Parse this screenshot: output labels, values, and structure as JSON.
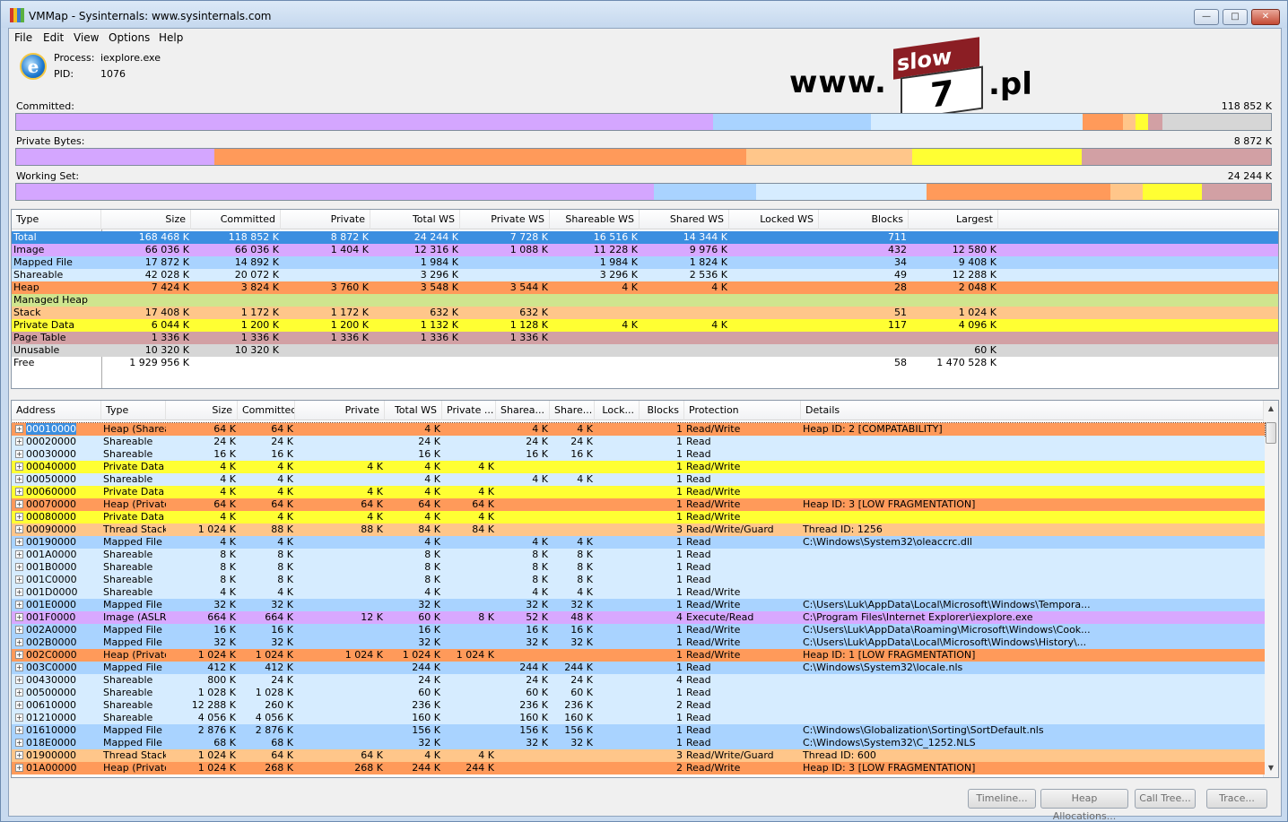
{
  "window": {
    "title": "VMMap - Sysinternals: www.sysinternals.com",
    "buttons": {
      "minimize": "—",
      "maximize": "□",
      "close": "✕"
    }
  },
  "menu": [
    "File",
    "Edit",
    "View",
    "Options",
    "Help"
  ],
  "process": {
    "process_label": "Process:",
    "process_value": "iexplore.exe",
    "pid_label": "PID:",
    "pid_value": "1076"
  },
  "logo": {
    "www": "www.",
    "slow": "slow",
    "seven": "7",
    "pl": ".pl"
  },
  "colors": {
    "image": "#d8a8ff",
    "mapped": "#a9d3ff",
    "shareable": "#d6ecff",
    "heap": "#ff9a5a",
    "managed": "#cfe58e",
    "stack": "#ffc68a",
    "private": "#ffff33",
    "pagetable": "#d2a0a4",
    "unusable": "#d6d6d6",
    "total": "#3b8ee0"
  },
  "bars": [
    {
      "label": "Committed:",
      "value": "118 852 K",
      "segments": [
        {
          "color": "#d4a6ff",
          "frac": 0.5557
        },
        {
          "color": "#a9d3ff",
          "frac": 0.1253
        },
        {
          "color": "#d6ecff",
          "frac": 0.1689
        },
        {
          "color": "#ff9a5a",
          "frac": 0.0322
        },
        {
          "color": "#ffc68a",
          "frac": 0.0099
        },
        {
          "color": "#ffff33",
          "frac": 0.0101
        },
        {
          "color": "#d2a0a4",
          "frac": 0.0112
        },
        {
          "color": "#d6d6d6",
          "frac": 0.0868
        }
      ]
    },
    {
      "label": "Private Bytes:",
      "value": "8 872 K",
      "segments": [
        {
          "color": "#d4a6ff",
          "frac": 0.1582
        },
        {
          "color": "#ff9a5a",
          "frac": 0.4238
        },
        {
          "color": "#ffc68a",
          "frac": 0.132
        },
        {
          "color": "#ffff33",
          "frac": 0.1353
        },
        {
          "color": "#d2a0a4",
          "frac": 0.1506
        }
      ]
    },
    {
      "label": "Working Set:",
      "value": "24 244 K",
      "segments": [
        {
          "color": "#d4a6ff",
          "frac": 0.508
        },
        {
          "color": "#a9d3ff",
          "frac": 0.0818
        },
        {
          "color": "#d6ecff",
          "frac": 0.1359
        },
        {
          "color": "#ff9a5a",
          "frac": 0.1463
        },
        {
          "color": "#ffc68a",
          "frac": 0.0261
        },
        {
          "color": "#ffff33",
          "frac": 0.0467
        },
        {
          "color": "#d2a0a4",
          "frac": 0.0551
        }
      ]
    }
  ],
  "summary": {
    "headers": [
      "Type",
      "Size",
      "Committed",
      "Private",
      "Total WS",
      "Private WS",
      "Shareable WS",
      "Shared WS",
      "Locked WS",
      "Blocks",
      "Largest"
    ],
    "rows": [
      {
        "bg": "#3b8ee0",
        "fg": "#ffffff",
        "cells": [
          "Total",
          "168 468 K",
          "118 852 K",
          "8 872 K",
          "24 244 K",
          "7 728 K",
          "16 516 K",
          "14 344 K",
          "",
          "711",
          ""
        ]
      },
      {
        "bg": "#d8a8ff",
        "fg": "#000",
        "cells": [
          "Image",
          "66 036 K",
          "66 036 K",
          "1 404 K",
          "12 316 K",
          "1 088 K",
          "11 228 K",
          "9 976 K",
          "",
          "432",
          "12 580 K"
        ]
      },
      {
        "bg": "#a9d3ff",
        "fg": "#000",
        "cells": [
          "Mapped File",
          "17 872 K",
          "14 892 K",
          "",
          "1 984 K",
          "",
          "1 984 K",
          "1 824 K",
          "",
          "34",
          "9 408 K"
        ]
      },
      {
        "bg": "#d6ecff",
        "fg": "#000",
        "cells": [
          "Shareable",
          "42 028 K",
          "20 072 K",
          "",
          "3 296 K",
          "",
          "3 296 K",
          "2 536 K",
          "",
          "49",
          "12 288 K"
        ]
      },
      {
        "bg": "#ff9a5a",
        "fg": "#000",
        "cells": [
          "Heap",
          "7 424 K",
          "3 824 K",
          "3 760 K",
          "3 548 K",
          "3 544 K",
          "4 K",
          "4 K",
          "",
          "28",
          "2 048 K"
        ]
      },
      {
        "bg": "#cfe58e",
        "fg": "#000",
        "cells": [
          "Managed Heap",
          "",
          "",
          "",
          "",
          "",
          "",
          "",
          "",
          "",
          ""
        ]
      },
      {
        "bg": "#ffc68a",
        "fg": "#000",
        "cells": [
          "Stack",
          "17 408 K",
          "1 172 K",
          "1 172 K",
          "632 K",
          "632 K",
          "",
          "",
          "",
          "51",
          "1 024 K"
        ]
      },
      {
        "bg": "#ffff33",
        "fg": "#000",
        "cells": [
          "Private Data",
          "6 044 K",
          "1 200 K",
          "1 200 K",
          "1 132 K",
          "1 128 K",
          "4 K",
          "4 K",
          "",
          "117",
          "4 096 K"
        ]
      },
      {
        "bg": "#d2a0a4",
        "fg": "#000",
        "cells": [
          "Page Table",
          "1 336 K",
          "1 336 K",
          "1 336 K",
          "1 336 K",
          "1 336 K",
          "",
          "",
          "",
          "",
          ""
        ]
      },
      {
        "bg": "#d6d6d6",
        "fg": "#000",
        "cells": [
          "Unusable",
          "10 320 K",
          "10 320 K",
          "",
          "",
          "",
          "",
          "",
          "",
          "",
          "60 K"
        ]
      },
      {
        "bg": "#ffffff",
        "fg": "#000",
        "cells": [
          "Free",
          "1 929 956 K",
          "",
          "",
          "",
          "",
          "",
          "",
          "",
          "58",
          "1 470 528 K"
        ]
      }
    ]
  },
  "detail": {
    "headers": [
      "Address",
      "Type",
      "Size",
      "Committed",
      "Private",
      "Total WS",
      "Private ...",
      "Sharea...",
      "Share...",
      "Lock...",
      "Blocks",
      "Protection",
      "Details"
    ],
    "sort_arrow": "^",
    "rows": [
      {
        "bg": "#ff9a5a",
        "fg": "#000",
        "sel": true,
        "cells": [
          "00010000",
          "Heap (Shareable)",
          "64 K",
          "64 K",
          "",
          "4 K",
          "",
          "4 K",
          "4 K",
          "",
          "1",
          "Read/Write",
          "Heap ID: 2 [COMPATABILITY]"
        ]
      },
      {
        "bg": "#d6ecff",
        "cells": [
          "00020000",
          "Shareable",
          "24 K",
          "24 K",
          "",
          "24 K",
          "",
          "24 K",
          "24 K",
          "",
          "1",
          "Read",
          ""
        ]
      },
      {
        "bg": "#d6ecff",
        "cells": [
          "00030000",
          "Shareable",
          "16 K",
          "16 K",
          "",
          "16 K",
          "",
          "16 K",
          "16 K",
          "",
          "1",
          "Read",
          ""
        ]
      },
      {
        "bg": "#ffff33",
        "cells": [
          "00040000",
          "Private Data",
          "4 K",
          "4 K",
          "4 K",
          "4 K",
          "4 K",
          "",
          "",
          "",
          "1",
          "Read/Write",
          ""
        ]
      },
      {
        "bg": "#d6ecff",
        "cells": [
          "00050000",
          "Shareable",
          "4 K",
          "4 K",
          "",
          "4 K",
          "",
          "4 K",
          "4 K",
          "",
          "1",
          "Read",
          ""
        ]
      },
      {
        "bg": "#ffff33",
        "cells": [
          "00060000",
          "Private Data",
          "4 K",
          "4 K",
          "4 K",
          "4 K",
          "4 K",
          "",
          "",
          "",
          "1",
          "Read/Write",
          ""
        ]
      },
      {
        "bg": "#ff9a5a",
        "cells": [
          "00070000",
          "Heap (Private Data)",
          "64 K",
          "64 K",
          "64 K",
          "64 K",
          "64 K",
          "",
          "",
          "",
          "1",
          "Read/Write",
          "Heap ID: 3 [LOW FRAGMENTATION]"
        ]
      },
      {
        "bg": "#ffff33",
        "cells": [
          "00080000",
          "Private Data",
          "4 K",
          "4 K",
          "4 K",
          "4 K",
          "4 K",
          "",
          "",
          "",
          "1",
          "Read/Write",
          ""
        ]
      },
      {
        "bg": "#ffc68a",
        "cells": [
          "00090000",
          "Thread Stack",
          "1 024 K",
          "88 K",
          "88 K",
          "84 K",
          "84 K",
          "",
          "",
          "",
          "3",
          "Read/Write/Guard",
          "Thread ID: 1256"
        ]
      },
      {
        "bg": "#a9d3ff",
        "cells": [
          "00190000",
          "Mapped File",
          "4 K",
          "4 K",
          "",
          "4 K",
          "",
          "4 K",
          "4 K",
          "",
          "1",
          "Read",
          "C:\\Windows\\System32\\oleaccrc.dll"
        ]
      },
      {
        "bg": "#d6ecff",
        "cells": [
          "001A0000",
          "Shareable",
          "8 K",
          "8 K",
          "",
          "8 K",
          "",
          "8 K",
          "8 K",
          "",
          "1",
          "Read",
          ""
        ]
      },
      {
        "bg": "#d6ecff",
        "cells": [
          "001B0000",
          "Shareable",
          "8 K",
          "8 K",
          "",
          "8 K",
          "",
          "8 K",
          "8 K",
          "",
          "1",
          "Read",
          ""
        ]
      },
      {
        "bg": "#d6ecff",
        "cells": [
          "001C0000",
          "Shareable",
          "8 K",
          "8 K",
          "",
          "8 K",
          "",
          "8 K",
          "8 K",
          "",
          "1",
          "Read",
          ""
        ]
      },
      {
        "bg": "#d6ecff",
        "cells": [
          "001D0000",
          "Shareable",
          "4 K",
          "4 K",
          "",
          "4 K",
          "",
          "4 K",
          "4 K",
          "",
          "1",
          "Read/Write",
          ""
        ]
      },
      {
        "bg": "#a9d3ff",
        "cells": [
          "001E0000",
          "Mapped File",
          "32 K",
          "32 K",
          "",
          "32 K",
          "",
          "32 K",
          "32 K",
          "",
          "1",
          "Read/Write",
          "C:\\Users\\Luk\\AppData\\Local\\Microsoft\\Windows\\Tempora..."
        ]
      },
      {
        "bg": "#d8a8ff",
        "cells": [
          "001F0000",
          "Image (ASLR)",
          "664 K",
          "664 K",
          "12 K",
          "60 K",
          "8 K",
          "52 K",
          "48 K",
          "",
          "4",
          "Execute/Read",
          "C:\\Program Files\\Internet Explorer\\iexplore.exe"
        ]
      },
      {
        "bg": "#a9d3ff",
        "cells": [
          "002A0000",
          "Mapped File",
          "16 K",
          "16 K",
          "",
          "16 K",
          "",
          "16 K",
          "16 K",
          "",
          "1",
          "Read/Write",
          "C:\\Users\\Luk\\AppData\\Roaming\\Microsoft\\Windows\\Cook..."
        ]
      },
      {
        "bg": "#a9d3ff",
        "cells": [
          "002B0000",
          "Mapped File",
          "32 K",
          "32 K",
          "",
          "32 K",
          "",
          "32 K",
          "32 K",
          "",
          "1",
          "Read/Write",
          "C:\\Users\\Luk\\AppData\\Local\\Microsoft\\Windows\\History\\..."
        ]
      },
      {
        "bg": "#ff9a5a",
        "cells": [
          "002C0000",
          "Heap (Private Data)",
          "1 024 K",
          "1 024 K",
          "1 024 K",
          "1 024 K",
          "1 024 K",
          "",
          "",
          "",
          "1",
          "Read/Write",
          "Heap ID: 1 [LOW FRAGMENTATION]"
        ]
      },
      {
        "bg": "#a9d3ff",
        "cells": [
          "003C0000",
          "Mapped File",
          "412 K",
          "412 K",
          "",
          "244 K",
          "",
          "244 K",
          "244 K",
          "",
          "1",
          "Read",
          "C:\\Windows\\System32\\locale.nls"
        ]
      },
      {
        "bg": "#d6ecff",
        "cells": [
          "00430000",
          "Shareable",
          "800 K",
          "24 K",
          "",
          "24 K",
          "",
          "24 K",
          "24 K",
          "",
          "4",
          "Read",
          ""
        ]
      },
      {
        "bg": "#d6ecff",
        "cells": [
          "00500000",
          "Shareable",
          "1 028 K",
          "1 028 K",
          "",
          "60 K",
          "",
          "60 K",
          "60 K",
          "",
          "1",
          "Read",
          ""
        ]
      },
      {
        "bg": "#d6ecff",
        "cells": [
          "00610000",
          "Shareable",
          "12 288 K",
          "260 K",
          "",
          "236 K",
          "",
          "236 K",
          "236 K",
          "",
          "2",
          "Read",
          ""
        ]
      },
      {
        "bg": "#d6ecff",
        "cells": [
          "01210000",
          "Shareable",
          "4 056 K",
          "4 056 K",
          "",
          "160 K",
          "",
          "160 K",
          "160 K",
          "",
          "1",
          "Read",
          ""
        ]
      },
      {
        "bg": "#a9d3ff",
        "cells": [
          "01610000",
          "Mapped File",
          "2 876 K",
          "2 876 K",
          "",
          "156 K",
          "",
          "156 K",
          "156 K",
          "",
          "1",
          "Read",
          "C:\\Windows\\Globalization\\Sorting\\SortDefault.nls"
        ]
      },
      {
        "bg": "#a9d3ff",
        "cells": [
          "018E0000",
          "Mapped File",
          "68 K",
          "68 K",
          "",
          "32 K",
          "",
          "32 K",
          "32 K",
          "",
          "1",
          "Read",
          "C:\\Windows\\System32\\C_1252.NLS"
        ]
      },
      {
        "bg": "#ffc68a",
        "cells": [
          "01900000",
          "Thread Stack",
          "1 024 K",
          "64 K",
          "64 K",
          "4 K",
          "4 K",
          "",
          "",
          "",
          "3",
          "Read/Write/Guard",
          "Thread ID: 600"
        ]
      },
      {
        "bg": "#ff9a5a",
        "cells": [
          "01A00000",
          "Heap (Private Data)",
          "1 024 K",
          "268 K",
          "268 K",
          "244 K",
          "244 K",
          "",
          "",
          "",
          "2",
          "Read/Write",
          "Heap ID: 3 [LOW FRAGMENTATION]"
        ]
      }
    ]
  },
  "buttons": [
    "Timeline...",
    "Heap Allocations...",
    "Call Tree...",
    "Trace..."
  ],
  "scroll": {
    "up": "▲",
    "down": "▼"
  },
  "expander": "+"
}
